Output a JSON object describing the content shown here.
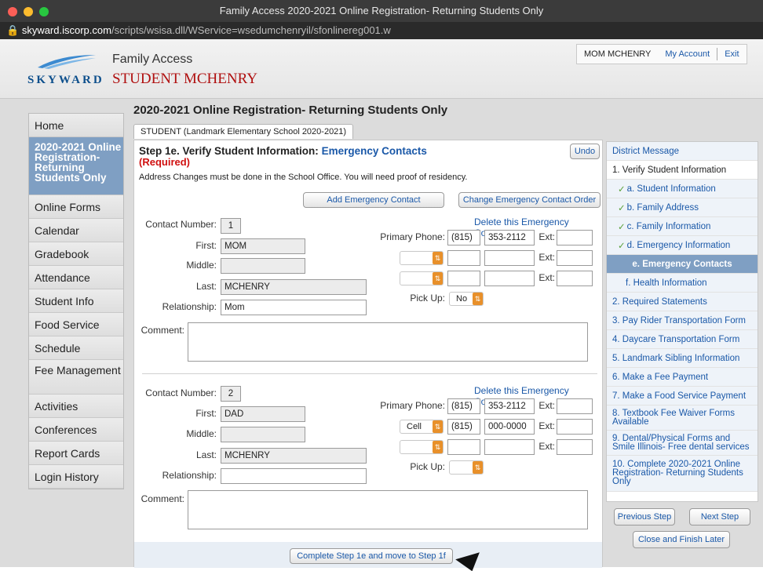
{
  "window": {
    "title": "Family Access 2020-2021 Online Registration- Returning Students Only"
  },
  "url": {
    "host": "skyward.iscorp.com",
    "path": "/scripts/wsisa.dll/WService=wsedumchenryil/sfonlinereg001.w"
  },
  "header": {
    "logo_text": "SKYWARD",
    "app_name": "Family Access",
    "student_name": "STUDENT MCHENRY",
    "user": "MOM MCHENRY",
    "my_account": "My Account",
    "exit": "Exit"
  },
  "nav": {
    "items": [
      "Home",
      "2020-2021 Online Registration- Returning Students Only",
      "Online Forms",
      "Calendar",
      "Gradebook",
      "Attendance",
      "Student Info",
      "Food Service",
      "Schedule",
      "Fee Management",
      "Activities",
      "Conferences",
      "Report Cards",
      "Login History"
    ]
  },
  "page_title": "2020-2021 Online Registration- Returning Students Only",
  "tab_label": "STUDENT (Landmark Elementary School 2020-2021)",
  "step": {
    "title": "Step 1e. Verify Student Information:",
    "title_blue": "Emergency Contacts",
    "required": "(Required)",
    "note": "Address Changes must be done in the School Office. You will need proof of residency.",
    "undo": "Undo",
    "add_contact": "Add Emergency Contact",
    "change_order": "Change Emergency Contact Order",
    "complete_button": "Complete Step 1e and move to Step 1f"
  },
  "labels": {
    "contact_number": "Contact Number:",
    "first": "First:",
    "middle": "Middle:",
    "last": "Last:",
    "relationship": "Relationship:",
    "comment": "Comment:",
    "primary_phone": "Primary Phone:",
    "ext": "Ext:",
    "pick_up": "Pick Up:",
    "delete": "Delete this Emergency Contact"
  },
  "contacts": [
    {
      "number": "1",
      "first": "MOM",
      "middle": "",
      "last": "MCHENRY",
      "relationship": "Mom",
      "phone_area": "(815)",
      "phone_num": "353-2112",
      "phone2_type": "",
      "phone2_area": "",
      "phone2_num": "",
      "pickup": "No"
    },
    {
      "number": "2",
      "first": "DAD",
      "middle": "",
      "last": "MCHENRY",
      "relationship": "",
      "phone_area": "(815)",
      "phone_num": "353-2112",
      "phone2_type": "Cell",
      "phone2_area": "(815)",
      "phone2_num": "000-0000",
      "pickup": ""
    }
  ],
  "side": {
    "items": [
      "District Message",
      "1. Verify Student Information",
      "a. Student Information",
      "b. Family Address",
      "c. Family Information",
      "d. Emergency Information",
      "e. Emergency Contacts",
      "f. Health Information",
      "2. Required Statements",
      "3. Pay Rider Transportation Form",
      "4. Daycare Transportation Form",
      "5. Landmark Sibling Information",
      "6. Make a Fee Payment",
      "7. Make a Food Service Payment",
      "8. Textbook Fee Waiver Forms Available",
      "9. Dental/Physical Forms and Smile Illinois- Free dental services",
      "10. Complete 2020-2021 Online Registration- Returning Students Only"
    ],
    "previous": "Previous Step",
    "next": "Next Step",
    "close": "Close and Finish Later"
  },
  "colors": {
    "accent": "#1a58a8",
    "nav_active": "#7f9fc3",
    "required": "#d01010",
    "select_arrow": "#e8902a"
  }
}
